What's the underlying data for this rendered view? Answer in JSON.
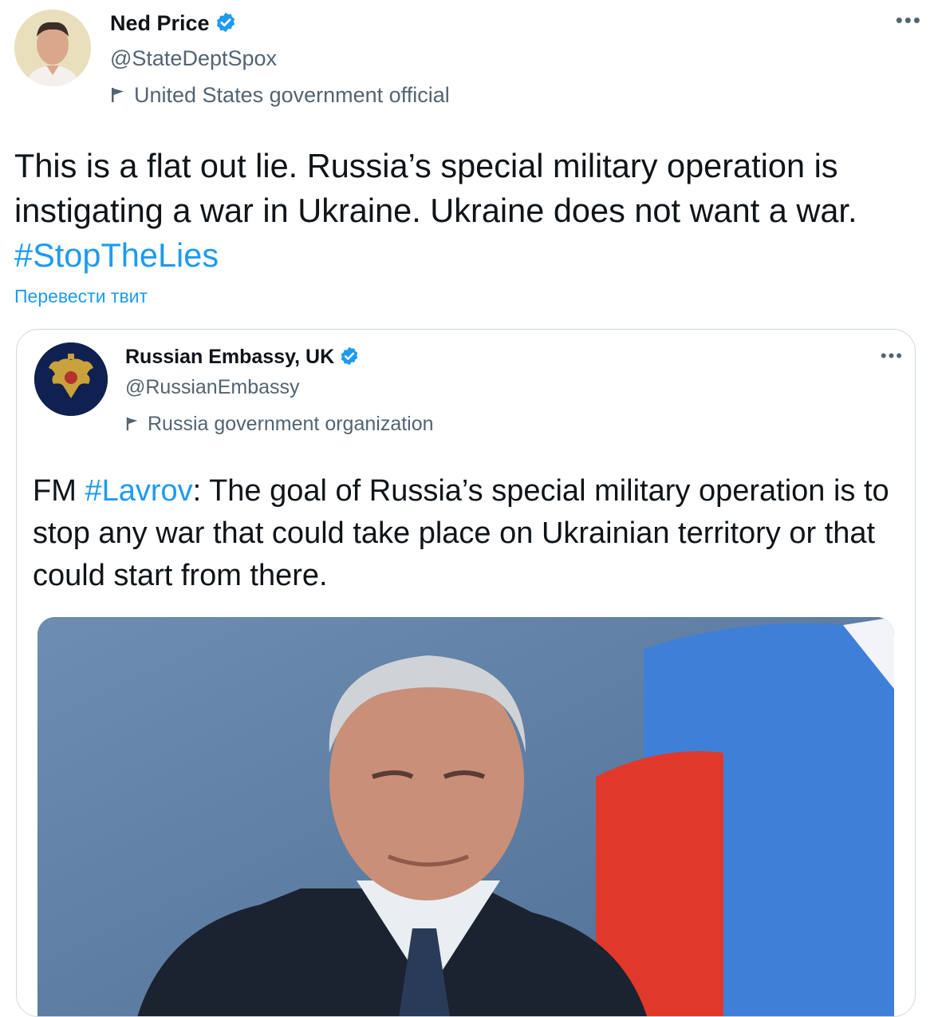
{
  "tweet": {
    "author_name": "Ned Price",
    "author_handle": "@StateDeptSpox",
    "account_label": "United States government official",
    "text_before_tag": "This is a flat out lie. Russia’s special military operation is instigating a war in Ukraine. Ukraine does not want a war. ",
    "hashtag": "#StopTheLies",
    "translate_link": "Перевести твит",
    "more_glyph": "•••"
  },
  "quoted_tweet": {
    "author_name": "Russian Embassy, UK",
    "author_handle": "@RussianEmbassy",
    "account_label": "Russia government organization",
    "text_prefix": "FM ",
    "hashtag": "#Lavrov",
    "text_after_tag": ": The goal of Russia’s special military operation is to stop any war that could take place on Ukrainian territory or that could start from there.",
    "more_glyph": "•••"
  },
  "colors": {
    "link_blue": "#1d9bf0",
    "verified_blue": "#1d9bf0",
    "secondary_text": "#536471",
    "card_border": "#cfd9de",
    "flag_white": "#ffffff",
    "flag_blue": "#3f7fd8",
    "flag_red": "#e0392c"
  },
  "icons": {
    "verified": "verified-badge-icon",
    "label_flag": "government-flag-icon",
    "more": "more-options-icon"
  }
}
